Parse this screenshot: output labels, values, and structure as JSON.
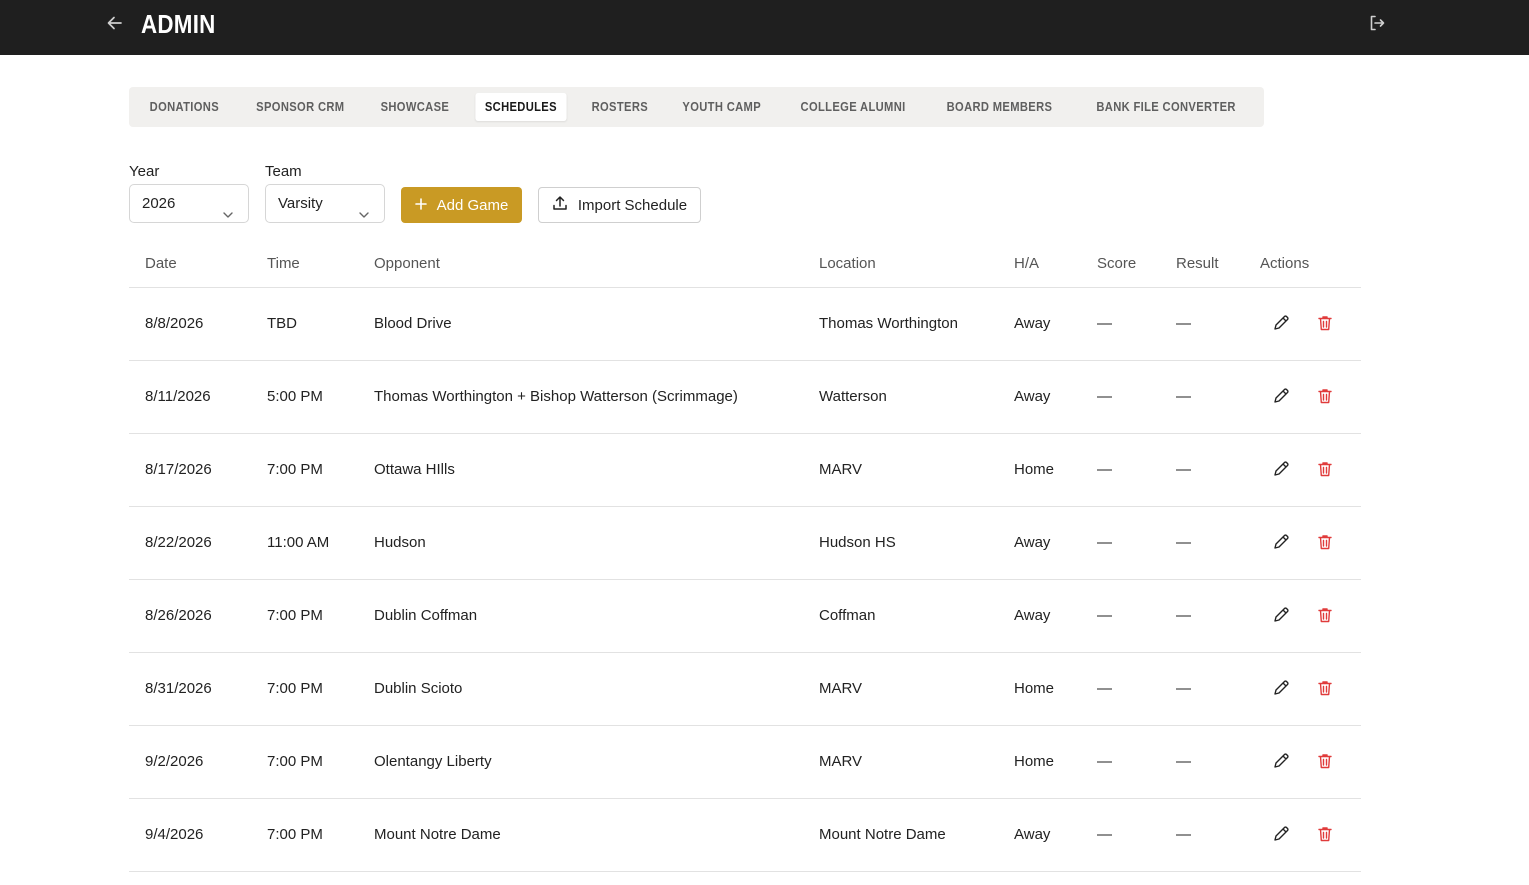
{
  "header": {
    "title": "ADMIN",
    "back_icon": "arrow-left-icon",
    "logout_icon": "logout-icon"
  },
  "tabs": [
    {
      "label": "DONATIONS",
      "active": false
    },
    {
      "label": "SPONSOR CRM",
      "active": false
    },
    {
      "label": "SHOWCASE",
      "active": false
    },
    {
      "label": "SCHEDULES",
      "active": true
    },
    {
      "label": "ROSTERS",
      "active": false
    },
    {
      "label": "YOUTH CAMP",
      "active": false
    },
    {
      "label": "COLLEGE ALUMNI",
      "active": false
    },
    {
      "label": "BOARD MEMBERS",
      "active": false
    },
    {
      "label": "BANK FILE CONVERTER",
      "active": false
    }
  ],
  "filters": {
    "year_label": "Year",
    "year_value": "2026",
    "team_label": "Team",
    "team_value": "Varsity"
  },
  "buttons": {
    "add_game": "Add Game",
    "import_schedule": "Import Schedule"
  },
  "colors": {
    "accent": "#c99a24",
    "topbar": "#1f1f1f",
    "delete": "#e03b3b"
  },
  "table": {
    "headers": {
      "date": "Date",
      "time": "Time",
      "opponent": "Opponent",
      "location": "Location",
      "ha": "H/A",
      "score": "Score",
      "result": "Result",
      "actions": "Actions"
    },
    "rows": [
      {
        "date": "8/8/2026",
        "time": "TBD",
        "opponent": "Blood Drive",
        "location": "Thomas Worthington",
        "ha": "Away",
        "score": "—",
        "result": "—"
      },
      {
        "date": "8/11/2026",
        "time": "5:00 PM",
        "opponent": "Thomas Worthington + Bishop Watterson (Scrimmage)",
        "location": "Watterson",
        "ha": "Away",
        "score": "—",
        "result": "—"
      },
      {
        "date": "8/17/2026",
        "time": "7:00 PM",
        "opponent": "Ottawa HIlls",
        "location": "MARV",
        "ha": "Home",
        "score": "—",
        "result": "—"
      },
      {
        "date": "8/22/2026",
        "time": "11:00 AM",
        "opponent": "Hudson",
        "location": "Hudson HS",
        "ha": "Away",
        "score": "—",
        "result": "—"
      },
      {
        "date": "8/26/2026",
        "time": "7:00 PM",
        "opponent": "Dublin Coffman",
        "location": "Coffman",
        "ha": "Away",
        "score": "—",
        "result": "—"
      },
      {
        "date": "8/31/2026",
        "time": "7:00 PM",
        "opponent": "Dublin Scioto",
        "location": "MARV",
        "ha": "Home",
        "score": "—",
        "result": "—"
      },
      {
        "date": "9/2/2026",
        "time": "7:00 PM",
        "opponent": "Olentangy Liberty",
        "location": "MARV",
        "ha": "Home",
        "score": "—",
        "result": "—"
      },
      {
        "date": "9/4/2026",
        "time": "7:00 PM",
        "opponent": "Mount Notre Dame",
        "location": "Mount Notre Dame",
        "ha": "Away",
        "score": "—",
        "result": "—"
      }
    ]
  }
}
